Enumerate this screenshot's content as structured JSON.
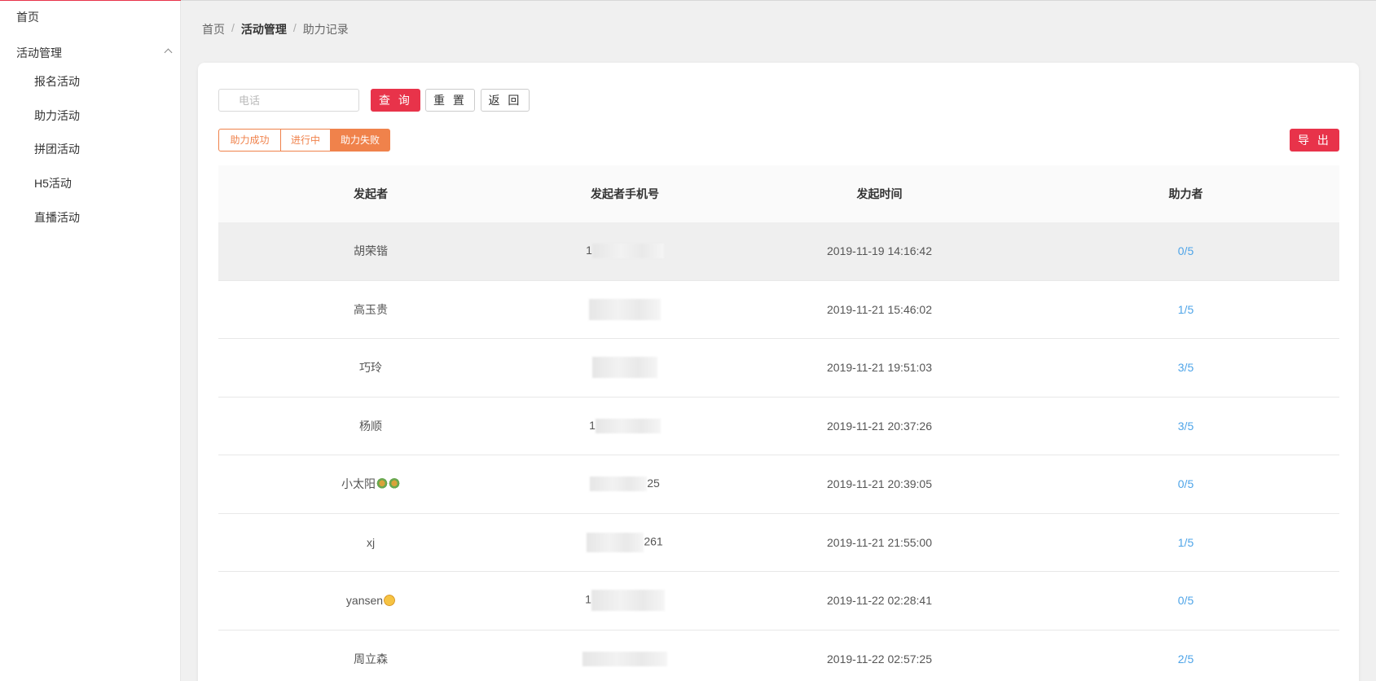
{
  "sidebar": {
    "home": "首页",
    "group": "活动管理",
    "items": [
      "报名活动",
      "助力活动",
      "拼团活动",
      "H5活动",
      "直播活动"
    ]
  },
  "breadcrumb": [
    "首页",
    "活动管理",
    "助力记录"
  ],
  "search": {
    "placeholder": "电话",
    "query": "查 询",
    "reset": "重 置",
    "back": "返 回"
  },
  "tabs": [
    "助力成功",
    "进行中",
    "助力失败"
  ],
  "active_tab": "助力失败",
  "export_label": "导 出",
  "table": {
    "headers": [
      "发起者",
      "发起者手机号",
      "发起时间",
      "助力者"
    ],
    "rows": [
      {
        "name": "胡荣锴",
        "phone_visible": "1",
        "time": "2019-11-19 14:16:42",
        "helpers": "0/5"
      },
      {
        "name": "高玉贵",
        "phone_visible": "",
        "time": "2019-11-21 15:46:02",
        "helpers": "1/5"
      },
      {
        "name": "巧玲",
        "phone_visible": "",
        "time": "2019-11-21 19:51:03",
        "helpers": "3/5"
      },
      {
        "name": "杨顺",
        "phone_visible": "1",
        "time": "2019-11-21 20:37:26",
        "helpers": "3/5"
      },
      {
        "name": "小太阳",
        "phone_visible": "25",
        "time": "2019-11-21 20:39:05",
        "helpers": "0/5",
        "emoji": "flower-icon"
      },
      {
        "name": "xj",
        "phone_visible": "261",
        "time": "2019-11-21 21:55:00",
        "helpers": "1/5"
      },
      {
        "name": "yansen",
        "phone_visible": "1",
        "time": "2019-11-22 02:28:41",
        "helpers": "0/5",
        "emoji": "smile-icon"
      },
      {
        "name": "周立森",
        "phone_visible": "",
        "time": "2019-11-22 02:57:25",
        "helpers": "2/5"
      }
    ]
  },
  "colors": {
    "primary": "#e8334a",
    "tab": "#f0824b",
    "link": "#4ea4e8"
  }
}
